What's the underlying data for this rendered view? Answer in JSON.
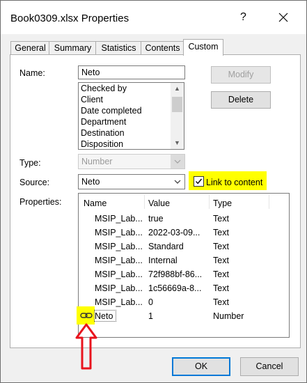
{
  "window": {
    "title": "Book0309.xlsx Properties",
    "help_glyph": "?",
    "close_icon": "close-icon"
  },
  "tabs": [
    {
      "label": "General"
    },
    {
      "label": "Summary"
    },
    {
      "label": "Statistics"
    },
    {
      "label": "Contents"
    },
    {
      "label": "Custom",
      "active": true
    }
  ],
  "form": {
    "name_label": "Name:",
    "name_value": "Neto",
    "name_options": [
      "Checked by",
      "Client",
      "Date completed",
      "Department",
      "Destination",
      "Disposition"
    ],
    "type_label": "Type:",
    "type_value": "Number",
    "source_label": "Source:",
    "source_value": "Neto",
    "link_label": "Link to content",
    "link_checked": true,
    "properties_label": "Properties:"
  },
  "buttons": {
    "modify": "Modify",
    "delete": "Delete",
    "ok": "OK",
    "cancel": "Cancel"
  },
  "properties": {
    "headers": [
      "Name",
      "Value",
      "Type"
    ],
    "rows": [
      {
        "name": "MSIP_Lab...",
        "value": "true",
        "type": "Text"
      },
      {
        "name": "MSIP_Lab...",
        "value": "2022-03-09...",
        "type": "Text"
      },
      {
        "name": "MSIP_Lab...",
        "value": "Standard",
        "type": "Text"
      },
      {
        "name": "MSIP_Lab...",
        "value": "Internal",
        "type": "Text"
      },
      {
        "name": "MSIP_Lab...",
        "value": "72f988bf-86...",
        "type": "Text"
      },
      {
        "name": "MSIP_Lab...",
        "value": "1c56669a-8...",
        "type": "Text"
      },
      {
        "name": "MSIP_Lab...",
        "value": "0",
        "type": "Text"
      },
      {
        "name": "Neto",
        "value": "1",
        "type": "Number",
        "linked": true
      }
    ]
  },
  "annotation": {
    "arrow_color": "#e8131d",
    "highlight_color": "#ffff00"
  }
}
